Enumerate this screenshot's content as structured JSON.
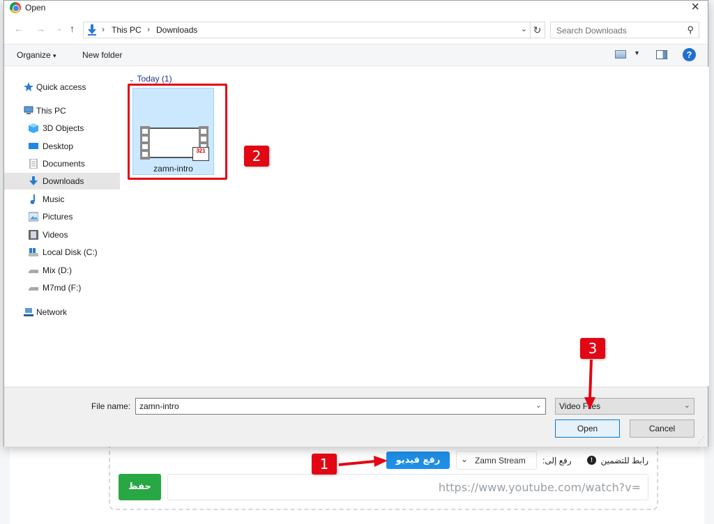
{
  "dialog": {
    "title": "Open",
    "address": {
      "crumbs": [
        "This PC",
        "Downloads"
      ],
      "search_placeholder": "Search Downloads"
    },
    "commands": {
      "organize": "Organize",
      "organize_caret": "▾",
      "new_folder": "New folder",
      "help": "?"
    },
    "nav_items": [
      {
        "label": "Quick access",
        "icon": "star-icon"
      },
      {
        "label": "This PC",
        "icon": "computer-icon"
      },
      {
        "label": "3D Objects",
        "icon": "cube-icon"
      },
      {
        "label": "Desktop",
        "icon": "desktop-icon"
      },
      {
        "label": "Documents",
        "icon": "document-icon"
      },
      {
        "label": "Downloads",
        "icon": "download-icon",
        "selected": true
      },
      {
        "label": "Music",
        "icon": "music-note-icon"
      },
      {
        "label": "Pictures",
        "icon": "picture-icon"
      },
      {
        "label": "Videos",
        "icon": "video-icon"
      },
      {
        "label": "Local Disk (C:)",
        "icon": "windows-drive-icon"
      },
      {
        "label": "Mix (D:)",
        "icon": "drive-icon"
      },
      {
        "label": "M7md (F:)",
        "icon": "drive-icon"
      },
      {
        "label": "Network",
        "icon": "network-icon"
      }
    ],
    "group_header": "Today (1)",
    "files": [
      {
        "name": "zamn-intro",
        "icon": "video-file-icon",
        "badge": "321"
      }
    ],
    "file_name_label": "File name:",
    "file_name_value": "zamn-intro",
    "file_type_value": "Video Files",
    "open_label": "Open",
    "cancel_label": "Cancel"
  },
  "page": {
    "embed_label": "رابط للتضمين",
    "info": "!",
    "upload_to_label": "رفع إلى:",
    "stream_value": "Zamn Stream",
    "upload_video_label": "رفع فيديو",
    "save_label": "حفظ",
    "url_placeholder": "https://www.youtube.com/watch?v="
  },
  "annotations": {
    "steps": [
      "1",
      "2",
      "3"
    ],
    "accent_color": "#e30613"
  }
}
